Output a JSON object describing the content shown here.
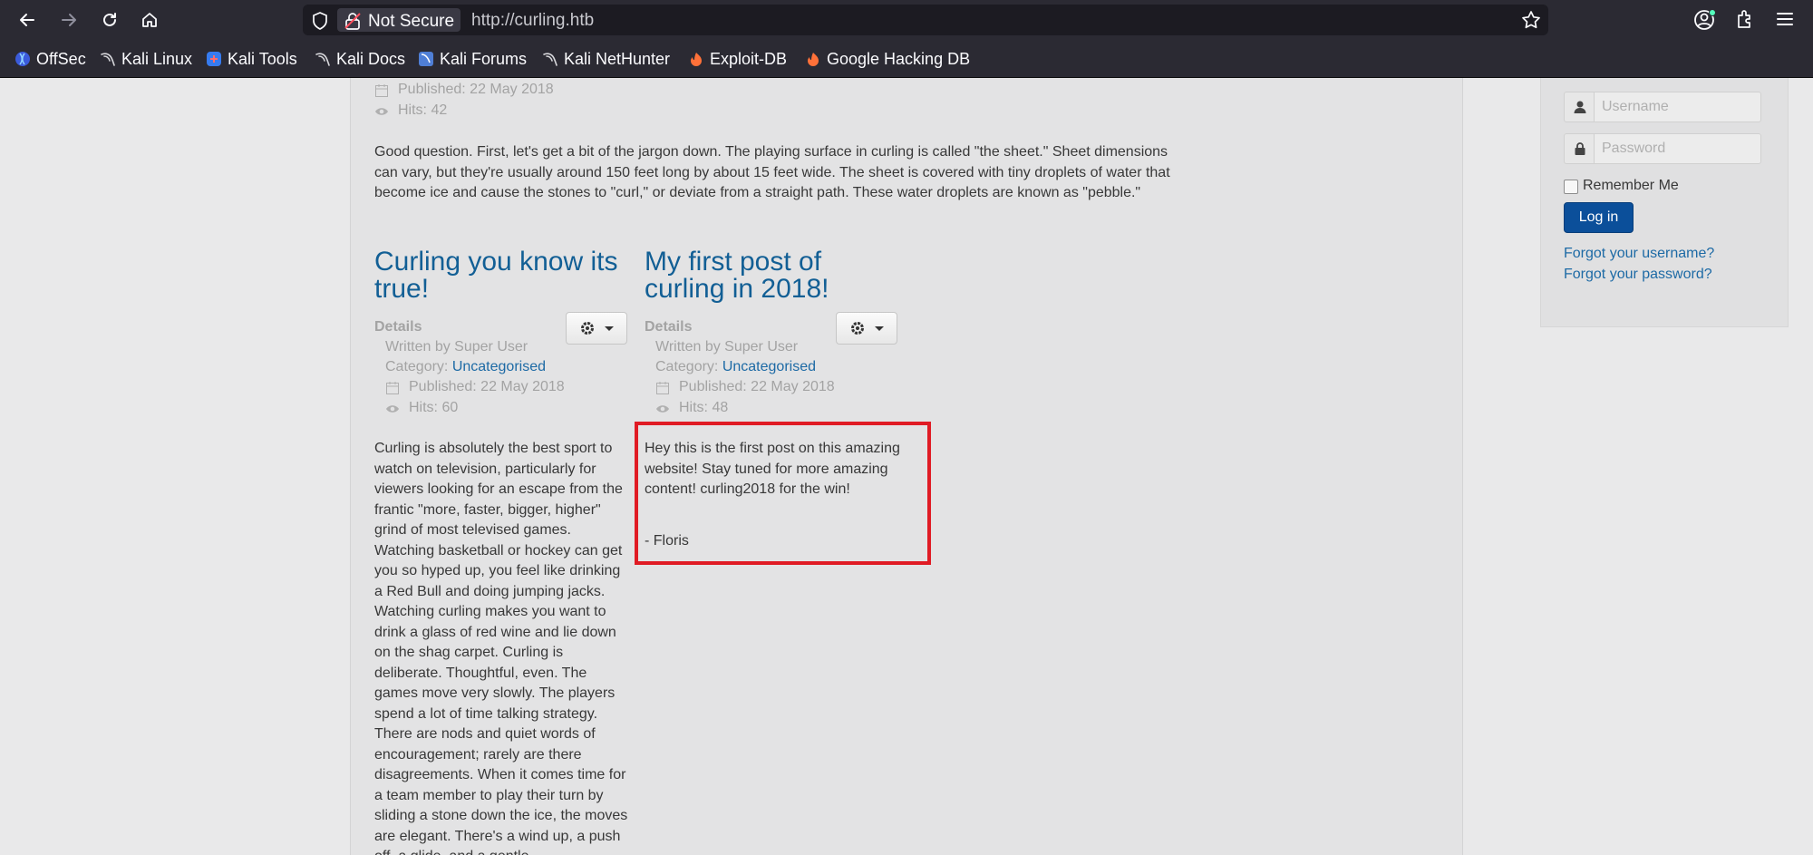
{
  "browser": {
    "security_label": "Not Secure",
    "url": "http://curling.htb",
    "bookmarks": [
      {
        "label": "OffSec",
        "icon": "offsec-icon"
      },
      {
        "label": "Kali Linux",
        "icon": "kali-dragon-icon"
      },
      {
        "label": "Kali Tools",
        "icon": "kali-tools-icon"
      },
      {
        "label": "Kali Docs",
        "icon": "kali-dragon-icon"
      },
      {
        "label": "Kali Forums",
        "icon": "kali-forums-icon"
      },
      {
        "label": "Kali NetHunter",
        "icon": "kali-dragon-icon"
      },
      {
        "label": "Exploit-DB",
        "icon": "exploit-db-icon"
      },
      {
        "label": "Google Hacking DB",
        "icon": "exploit-db-icon"
      }
    ]
  },
  "top_article": {
    "published": "Published: 22 May 2018",
    "hits": "Hits: 42",
    "body": "Good question. First, let's get a bit of the jargon down. The playing surface in curling is called \"the sheet.\" Sheet dimensions can vary, but they're usually around 150 feet long by about 15 feet wide. The sheet is covered with tiny droplets of water that become ice and cause the stones to \"curl,\" or deviate from a straight path. These water droplets are known as \"pebble.\""
  },
  "articles": [
    {
      "title": "Curling you know its true!",
      "details_label": "Details",
      "author": "Written by Super User",
      "category_label": "Category:",
      "category": "Uncategorised",
      "published": "Published: 22 May 2018",
      "hits": "Hits: 60",
      "body": "Curling is absolutely the best sport to watch on television, particularly for viewers looking for an escape from the frantic \"more, faster, bigger, higher\" grind of most televised games. Watching basketball or hockey can get you so hyped up, you feel like drinking a Red Bull and doing jumping jacks. Watching curling makes you want to drink a glass of red wine and lie down on the shag carpet. Curling is deliberate. Thoughtful, even. The games move very slowly. The players spend a lot of time talking strategy. There are nods and quiet words of encouragement; rarely are there disagreements. When it comes time for a team member to play their turn by sliding a stone down the ice, the moves are elegant. There's a wind up, a push off, a glide, and a gentle"
    },
    {
      "title": "My first post of curling in 2018!",
      "details_label": "Details",
      "author": "Written by Super User",
      "category_label": "Category:",
      "category": "Uncategorised",
      "published": "Published: 22 May 2018",
      "hits": "Hits: 48",
      "body": "Hey this is the first post on this amazing website! Stay tuned for more amazing content! curling2018 for the win!",
      "signature": "- Floris"
    }
  ],
  "login": {
    "username_placeholder": "Username",
    "password_placeholder": "Password",
    "remember_label": "Remember Me",
    "login_button": "Log in",
    "forgot_username": "Forgot your username?",
    "forgot_password": "Forgot your password?"
  },
  "colors": {
    "highlight": "#e01b24",
    "link": "#1d6aa5",
    "title": "#125f95",
    "login_button": "#0b4f9a"
  }
}
